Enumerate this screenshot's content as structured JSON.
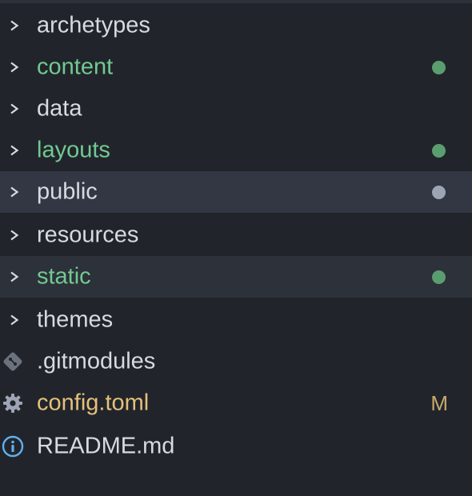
{
  "colors": {
    "background": "#21252b",
    "highlight": "#2c313a",
    "added": "#73c991",
    "modified": "#e5c07b",
    "text": "#d7dae0",
    "dot_green": "#5a9e6f",
    "dot_gray": "#9da5b4"
  },
  "tree": {
    "items": [
      {
        "name": "archetypes",
        "kind": "folder",
        "status": "none",
        "icon": "chevron-right-icon"
      },
      {
        "name": "content",
        "kind": "folder",
        "status": "added",
        "icon": "chevron-right-icon"
      },
      {
        "name": "data",
        "kind": "folder",
        "status": "none",
        "icon": "chevron-right-icon"
      },
      {
        "name": "layouts",
        "kind": "folder",
        "status": "added",
        "icon": "chevron-right-icon"
      },
      {
        "name": "public",
        "kind": "folder",
        "status": "ignored",
        "selected": true,
        "icon": "chevron-right-icon"
      },
      {
        "name": "resources",
        "kind": "folder",
        "status": "none",
        "icon": "chevron-right-icon"
      },
      {
        "name": "static",
        "kind": "folder",
        "status": "added",
        "selected": true,
        "icon": "chevron-right-icon"
      },
      {
        "name": "themes",
        "kind": "folder",
        "status": "none",
        "icon": "chevron-right-icon"
      },
      {
        "name": ".gitmodules",
        "kind": "file",
        "status": "none",
        "icon": "git-icon"
      },
      {
        "name": "config.toml",
        "kind": "file",
        "status": "modified",
        "badge": "M",
        "icon": "gear-icon"
      },
      {
        "name": "README.md",
        "kind": "file",
        "status": "none",
        "icon": "info-icon"
      }
    ]
  }
}
